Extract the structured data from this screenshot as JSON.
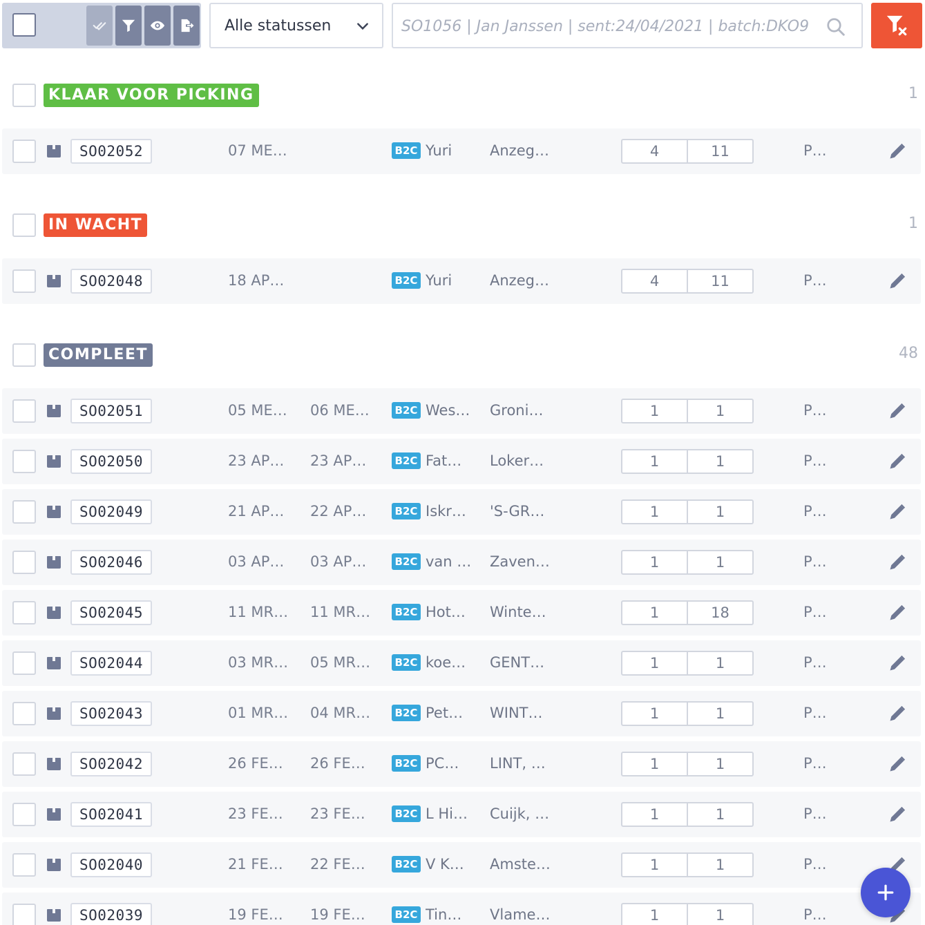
{
  "toolbar": {
    "status_select_value": "Alle statussen",
    "search_placeholder": "SO1056 | Jan Janssen | sent:24/04/2021 | batch:DKO9",
    "colors": {
      "clear_filter": "#ee5536",
      "bulk_button": "#7b849f"
    }
  },
  "groups": [
    {
      "label": "KLAAR VOOR PICKING",
      "color": "#5fbe45",
      "count": "1",
      "rows": [
        {
          "order": "SO02052",
          "date1": "07 ME…",
          "date2": "",
          "type": "B2C",
          "name": "Yuri",
          "city": "Anzeg…",
          "qty1": "4",
          "qty2": "11",
          "carrier": "P…"
        }
      ]
    },
    {
      "label": "IN WACHT",
      "color": "#ee5536",
      "count": "1",
      "rows": [
        {
          "order": "SO02048",
          "date1": "18 AP…",
          "date2": "",
          "type": "B2C",
          "name": "Yuri",
          "city": "Anzeg…",
          "qty1": "4",
          "qty2": "11",
          "carrier": "P…"
        }
      ]
    },
    {
      "label": "COMPLEET",
      "color": "#717b96",
      "count": "48",
      "rows": [
        {
          "order": "SO02051",
          "date1": "05 ME…",
          "date2": "06 ME…",
          "type": "B2C",
          "name": "Wes…",
          "city": "Groni…",
          "qty1": "1",
          "qty2": "1",
          "carrier": "P…"
        },
        {
          "order": "SO02050",
          "date1": "23 AP…",
          "date2": "23 AP…",
          "type": "B2C",
          "name": "Fat…",
          "city": "Loker…",
          "qty1": "1",
          "qty2": "1",
          "carrier": "P…"
        },
        {
          "order": "SO02049",
          "date1": "21 AP…",
          "date2": "22 AP…",
          "type": "B2C",
          "name": "Iskr…",
          "city": "'S-GR…",
          "qty1": "1",
          "qty2": "1",
          "carrier": "P…"
        },
        {
          "order": "SO02046",
          "date1": "03 AP…",
          "date2": "03 AP…",
          "type": "B2C",
          "name": "van …",
          "city": "Zaven…",
          "qty1": "1",
          "qty2": "1",
          "carrier": "P…"
        },
        {
          "order": "SO02045",
          "date1": "11 MR…",
          "date2": "11 MR…",
          "type": "B2C",
          "name": "Hot…",
          "city": "Winte…",
          "qty1": "1",
          "qty2": "18",
          "carrier": "P…"
        },
        {
          "order": "SO02044",
          "date1": "03 MR…",
          "date2": "05 MR…",
          "type": "B2C",
          "name": "koe…",
          "city": "GENT…",
          "qty1": "1",
          "qty2": "1",
          "carrier": "P…"
        },
        {
          "order": "SO02043",
          "date1": "01 MR…",
          "date2": "04 MR…",
          "type": "B2C",
          "name": "Pet…",
          "city": "WINT…",
          "qty1": "1",
          "qty2": "1",
          "carrier": "P…"
        },
        {
          "order": "SO02042",
          "date1": "26 FE…",
          "date2": "26 FE…",
          "type": "B2C",
          "name": "PC…",
          "city": "LINT, …",
          "qty1": "1",
          "qty2": "1",
          "carrier": "P…"
        },
        {
          "order": "SO02041",
          "date1": "23 FE…",
          "date2": "23 FE…",
          "type": "B2C",
          "name": "L Hi…",
          "city": "Cuijk, …",
          "qty1": "1",
          "qty2": "1",
          "carrier": "P…"
        },
        {
          "order": "SO02040",
          "date1": "21 FE…",
          "date2": "22 FE…",
          "type": "B2C",
          "name": "V K…",
          "city": "Amste…",
          "qty1": "1",
          "qty2": "1",
          "carrier": "P…"
        },
        {
          "order": "SO02039",
          "date1": "19 FE…",
          "date2": "19 FE…",
          "type": "B2C",
          "name": "Tin…",
          "city": "Vlame…",
          "qty1": "1",
          "qty2": "1",
          "carrier": "P…"
        }
      ]
    }
  ]
}
